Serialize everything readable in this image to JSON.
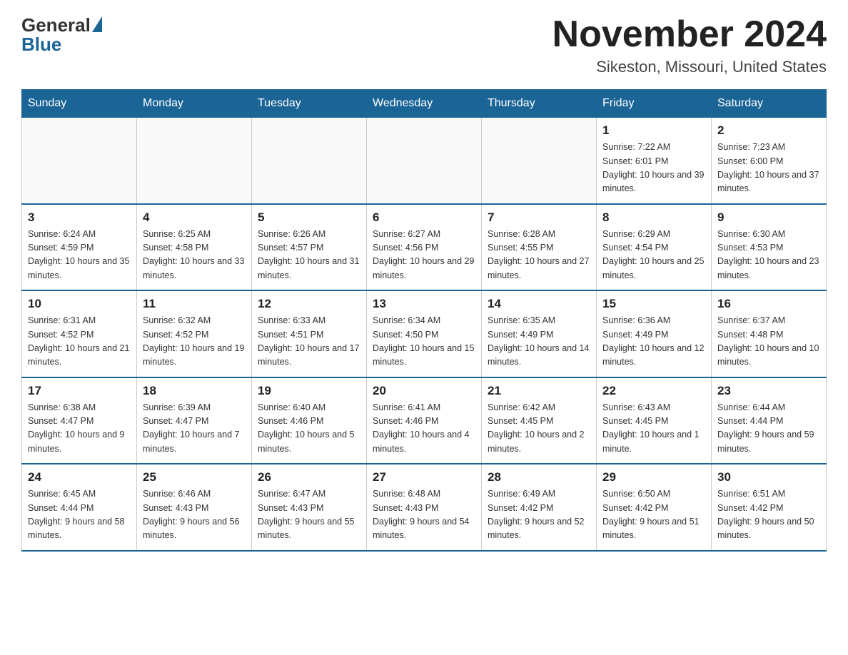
{
  "header": {
    "logo_general": "General",
    "logo_blue": "Blue",
    "month_title": "November 2024",
    "location": "Sikeston, Missouri, United States"
  },
  "weekdays": [
    "Sunday",
    "Monday",
    "Tuesday",
    "Wednesday",
    "Thursday",
    "Friday",
    "Saturday"
  ],
  "weeks": [
    [
      {
        "day": "",
        "sunrise": "",
        "sunset": "",
        "daylight": ""
      },
      {
        "day": "",
        "sunrise": "",
        "sunset": "",
        "daylight": ""
      },
      {
        "day": "",
        "sunrise": "",
        "sunset": "",
        "daylight": ""
      },
      {
        "day": "",
        "sunrise": "",
        "sunset": "",
        "daylight": ""
      },
      {
        "day": "",
        "sunrise": "",
        "sunset": "",
        "daylight": ""
      },
      {
        "day": "1",
        "sunrise": "Sunrise: 7:22 AM",
        "sunset": "Sunset: 6:01 PM",
        "daylight": "Daylight: 10 hours and 39 minutes."
      },
      {
        "day": "2",
        "sunrise": "Sunrise: 7:23 AM",
        "sunset": "Sunset: 6:00 PM",
        "daylight": "Daylight: 10 hours and 37 minutes."
      }
    ],
    [
      {
        "day": "3",
        "sunrise": "Sunrise: 6:24 AM",
        "sunset": "Sunset: 4:59 PM",
        "daylight": "Daylight: 10 hours and 35 minutes."
      },
      {
        "day": "4",
        "sunrise": "Sunrise: 6:25 AM",
        "sunset": "Sunset: 4:58 PM",
        "daylight": "Daylight: 10 hours and 33 minutes."
      },
      {
        "day": "5",
        "sunrise": "Sunrise: 6:26 AM",
        "sunset": "Sunset: 4:57 PM",
        "daylight": "Daylight: 10 hours and 31 minutes."
      },
      {
        "day": "6",
        "sunrise": "Sunrise: 6:27 AM",
        "sunset": "Sunset: 4:56 PM",
        "daylight": "Daylight: 10 hours and 29 minutes."
      },
      {
        "day": "7",
        "sunrise": "Sunrise: 6:28 AM",
        "sunset": "Sunset: 4:55 PM",
        "daylight": "Daylight: 10 hours and 27 minutes."
      },
      {
        "day": "8",
        "sunrise": "Sunrise: 6:29 AM",
        "sunset": "Sunset: 4:54 PM",
        "daylight": "Daylight: 10 hours and 25 minutes."
      },
      {
        "day": "9",
        "sunrise": "Sunrise: 6:30 AM",
        "sunset": "Sunset: 4:53 PM",
        "daylight": "Daylight: 10 hours and 23 minutes."
      }
    ],
    [
      {
        "day": "10",
        "sunrise": "Sunrise: 6:31 AM",
        "sunset": "Sunset: 4:52 PM",
        "daylight": "Daylight: 10 hours and 21 minutes."
      },
      {
        "day": "11",
        "sunrise": "Sunrise: 6:32 AM",
        "sunset": "Sunset: 4:52 PM",
        "daylight": "Daylight: 10 hours and 19 minutes."
      },
      {
        "day": "12",
        "sunrise": "Sunrise: 6:33 AM",
        "sunset": "Sunset: 4:51 PM",
        "daylight": "Daylight: 10 hours and 17 minutes."
      },
      {
        "day": "13",
        "sunrise": "Sunrise: 6:34 AM",
        "sunset": "Sunset: 4:50 PM",
        "daylight": "Daylight: 10 hours and 15 minutes."
      },
      {
        "day": "14",
        "sunrise": "Sunrise: 6:35 AM",
        "sunset": "Sunset: 4:49 PM",
        "daylight": "Daylight: 10 hours and 14 minutes."
      },
      {
        "day": "15",
        "sunrise": "Sunrise: 6:36 AM",
        "sunset": "Sunset: 4:49 PM",
        "daylight": "Daylight: 10 hours and 12 minutes."
      },
      {
        "day": "16",
        "sunrise": "Sunrise: 6:37 AM",
        "sunset": "Sunset: 4:48 PM",
        "daylight": "Daylight: 10 hours and 10 minutes."
      }
    ],
    [
      {
        "day": "17",
        "sunrise": "Sunrise: 6:38 AM",
        "sunset": "Sunset: 4:47 PM",
        "daylight": "Daylight: 10 hours and 9 minutes."
      },
      {
        "day": "18",
        "sunrise": "Sunrise: 6:39 AM",
        "sunset": "Sunset: 4:47 PM",
        "daylight": "Daylight: 10 hours and 7 minutes."
      },
      {
        "day": "19",
        "sunrise": "Sunrise: 6:40 AM",
        "sunset": "Sunset: 4:46 PM",
        "daylight": "Daylight: 10 hours and 5 minutes."
      },
      {
        "day": "20",
        "sunrise": "Sunrise: 6:41 AM",
        "sunset": "Sunset: 4:46 PM",
        "daylight": "Daylight: 10 hours and 4 minutes."
      },
      {
        "day": "21",
        "sunrise": "Sunrise: 6:42 AM",
        "sunset": "Sunset: 4:45 PM",
        "daylight": "Daylight: 10 hours and 2 minutes."
      },
      {
        "day": "22",
        "sunrise": "Sunrise: 6:43 AM",
        "sunset": "Sunset: 4:45 PM",
        "daylight": "Daylight: 10 hours and 1 minute."
      },
      {
        "day": "23",
        "sunrise": "Sunrise: 6:44 AM",
        "sunset": "Sunset: 4:44 PM",
        "daylight": "Daylight: 9 hours and 59 minutes."
      }
    ],
    [
      {
        "day": "24",
        "sunrise": "Sunrise: 6:45 AM",
        "sunset": "Sunset: 4:44 PM",
        "daylight": "Daylight: 9 hours and 58 minutes."
      },
      {
        "day": "25",
        "sunrise": "Sunrise: 6:46 AM",
        "sunset": "Sunset: 4:43 PM",
        "daylight": "Daylight: 9 hours and 56 minutes."
      },
      {
        "day": "26",
        "sunrise": "Sunrise: 6:47 AM",
        "sunset": "Sunset: 4:43 PM",
        "daylight": "Daylight: 9 hours and 55 minutes."
      },
      {
        "day": "27",
        "sunrise": "Sunrise: 6:48 AM",
        "sunset": "Sunset: 4:43 PM",
        "daylight": "Daylight: 9 hours and 54 minutes."
      },
      {
        "day": "28",
        "sunrise": "Sunrise: 6:49 AM",
        "sunset": "Sunset: 4:42 PM",
        "daylight": "Daylight: 9 hours and 52 minutes."
      },
      {
        "day": "29",
        "sunrise": "Sunrise: 6:50 AM",
        "sunset": "Sunset: 4:42 PM",
        "daylight": "Daylight: 9 hours and 51 minutes."
      },
      {
        "day": "30",
        "sunrise": "Sunrise: 6:51 AM",
        "sunset": "Sunset: 4:42 PM",
        "daylight": "Daylight: 9 hours and 50 minutes."
      }
    ]
  ]
}
